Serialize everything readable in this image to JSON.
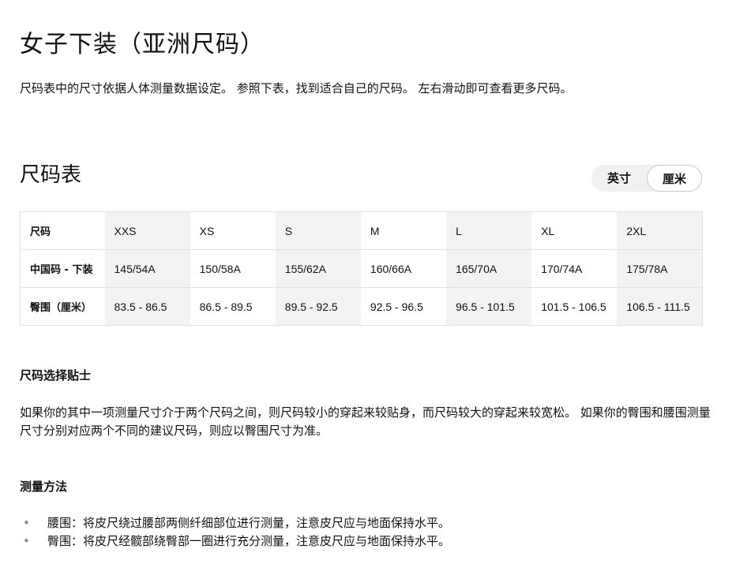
{
  "page_title": "女子下装（亚洲尺码）",
  "intro": "尺码表中的尺寸依据人体测量数据设定。 参照下表，找到适合自己的尺码。 左右滑动即可查看更多尺码。",
  "size_chart": {
    "title": "尺码表",
    "units": {
      "inch_label": "英寸",
      "cm_label": "厘米",
      "selected": "厘米"
    },
    "rows": [
      {
        "label": "尺码",
        "cells": [
          "XXS",
          "XS",
          "S",
          "M",
          "L",
          "XL",
          "2XL"
        ]
      },
      {
        "label": "中国码 - 下装",
        "cells": [
          "145/54A",
          "150/58A",
          "155/62A",
          "160/66A",
          "165/70A",
          "170/74A",
          "175/78A"
        ]
      },
      {
        "label": "臀围（厘米）",
        "cells": [
          "83.5 - 86.5",
          "86.5 - 89.5",
          "89.5 - 92.5",
          "92.5 - 96.5",
          "96.5 - 101.5",
          "101.5 - 106.5",
          "106.5 - 111.5"
        ]
      }
    ]
  },
  "tips": {
    "title": "尺码选择贴士",
    "body": "如果你的其中一项测量尺寸介于两个尺码之间，则尺码较小的穿起来较贴身，而尺码较大的穿起来较宽松。 如果你的臀围和腰围测量尺寸分别对应两个不同的建议尺码，则应以臀围尺寸为准。"
  },
  "measure": {
    "title": "测量方法",
    "bullet": "•",
    "items": [
      "腰围：将皮尺绕过腰部两侧纤细部位进行测量，注意皮尺应与地面保持水平。",
      "臀围：将皮尺经髋部绕臀部一圈进行充分测量，注意皮尺应与地面保持水平。"
    ]
  }
}
